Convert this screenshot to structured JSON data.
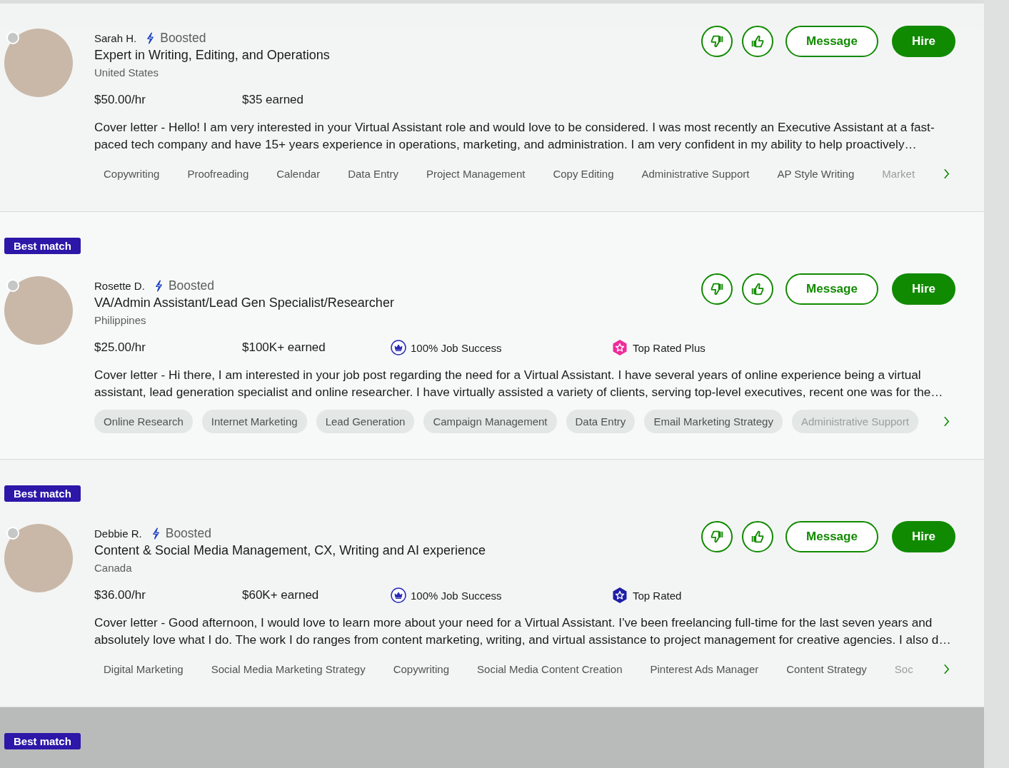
{
  "cards": [
    {
      "name": "Sarah H.",
      "boosted": "Boosted",
      "title": "Expert in Writing, Editing, and Operations",
      "country": "United States",
      "message": "Message",
      "hire": "Hire",
      "rate": "$50.00/hr",
      "earned": "$35 earned",
      "highlighted": false,
      "cover_letter": "Cover letter - Hello! I am very interested in your Virtual Assistant role and would love to be considered. I was most recently an Executive Assistant at a fast-paced tech company and have 15+ years experience in operations, marketing, and administration. I am very confident in my ability to help proactively…",
      "skills": [
        "Copywriting",
        "Proofreading",
        "Calendar",
        "Data Entry",
        "Project Management",
        "Copy Editing",
        "Administrative Support",
        "AP Style Writing",
        "Market"
      ]
    },
    {
      "badge": "Best match",
      "name": "Rosette D.",
      "boosted": "Boosted",
      "title": "VA/Admin Assistant/Lead Gen Specialist/Researcher",
      "country": "Philippines",
      "message": "Message",
      "hire": "Hire",
      "rate": "$25.00/hr",
      "earned": "$100K+ earned",
      "job_success": "100% Job Success",
      "rating": {
        "kind": "top_rated_plus",
        "label": "Top Rated Plus"
      },
      "highlighted": true,
      "cover_letter": "Cover letter - Hi there, I am interested in your job post regarding the need for a Virtual Assistant. I have several years of online experience being a virtual assistant, lead generation specialist and online researcher. I have virtually assisted a variety of clients, serving top-level executives, recent one was for the…",
      "skills": [
        "Online Research",
        "Internet Marketing",
        "Lead Generation",
        "Campaign Management",
        "Data Entry",
        "Email Marketing Strategy",
        "Administrative Support"
      ]
    },
    {
      "badge": "Best match",
      "name": "Debbie R.",
      "boosted": "Boosted",
      "title": "Content & Social Media Management, CX, Writing and AI experience",
      "country": "Canada",
      "message": "Message",
      "hire": "Hire",
      "rate": "$36.00/hr",
      "earned": "$60K+ earned",
      "job_success": "100% Job Success",
      "rating": {
        "kind": "top_rated",
        "label": "Top Rated"
      },
      "highlighted": false,
      "cover_letter": "Cover letter - Good afternoon, I would love to learn more about your need for a Virtual Assistant. I've been freelancing full-time for the last seven years and absolutely love what I do. The work I do ranges from content marketing, writing, and virtual assistance to project management for creative agencies. I also d…",
      "skills": [
        "Digital Marketing",
        "Social Media Marketing Strategy",
        "Copywriting",
        "Social Media Content Creation",
        "Pinterest Ads Manager",
        "Content Strategy",
        "Soc"
      ]
    }
  ],
  "next_card_badge": "Best match"
}
